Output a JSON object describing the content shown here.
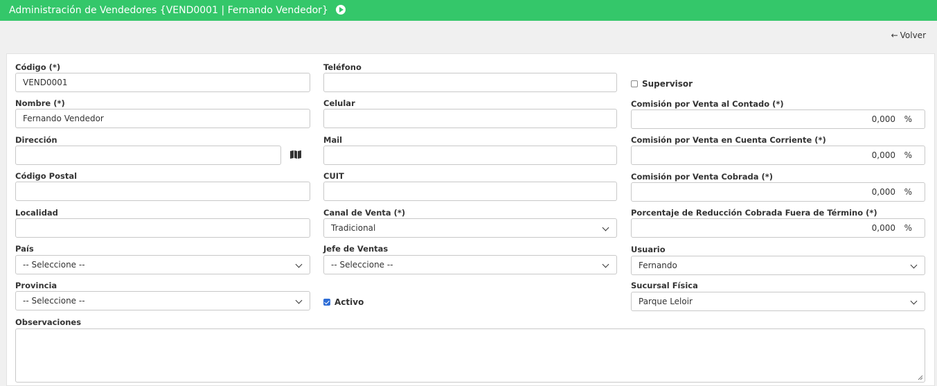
{
  "header": {
    "title": "Administración de Vendedores {VEND0001 | Fernando Vendedor}",
    "play_icon": "play-circle-icon",
    "color": "#34c76a"
  },
  "nav": {
    "back_arrow": "←",
    "back_label": "Volver"
  },
  "form": {
    "codigo": {
      "label": "Código (*)",
      "value": "VEND0001"
    },
    "nombre": {
      "label": "Nombre (*)",
      "value": "Fernando Vendedor"
    },
    "direccion": {
      "label": "Dirección",
      "value": "",
      "map_icon": "map-icon"
    },
    "codigo_postal": {
      "label": "Código Postal",
      "value": ""
    },
    "localidad": {
      "label": "Localidad",
      "value": ""
    },
    "pais": {
      "label": "País",
      "value": "-- Seleccione --"
    },
    "provincia": {
      "label": "Provincia",
      "value": "-- Seleccione --"
    },
    "telefono": {
      "label": "Teléfono",
      "value": ""
    },
    "celular": {
      "label": "Celular",
      "value": ""
    },
    "mail": {
      "label": "Mail",
      "value": ""
    },
    "cuit": {
      "label": "CUIT",
      "value": ""
    },
    "canal_venta": {
      "label": "Canal de Venta (*)",
      "value": "Tradicional"
    },
    "jefe_ventas": {
      "label": "Jefe de Ventas",
      "value": "-- Seleccione --"
    },
    "activo": {
      "label": "Activo",
      "checked": true
    },
    "supervisor": {
      "label": "Supervisor",
      "checked": false
    },
    "comision_contado": {
      "label": "Comisión por Venta al Contado (*)",
      "value": "0,000",
      "unit": "%"
    },
    "comision_cta_cte": {
      "label": "Comisión por Venta en Cuenta Corriente (*)",
      "value": "0,000",
      "unit": "%"
    },
    "comision_cobrada": {
      "label": "Comisión por Venta Cobrada (*)",
      "value": "0,000",
      "unit": "%"
    },
    "reduccion": {
      "label": "Porcentaje de Reducción Cobrada Fuera de Término (*)",
      "value": "0,000",
      "unit": "%"
    },
    "usuario": {
      "label": "Usuario",
      "value": "Fernando"
    },
    "sucursal": {
      "label": "Sucursal Física",
      "value": "Parque Leloir"
    },
    "observaciones": {
      "label": "Observaciones",
      "value": ""
    }
  }
}
